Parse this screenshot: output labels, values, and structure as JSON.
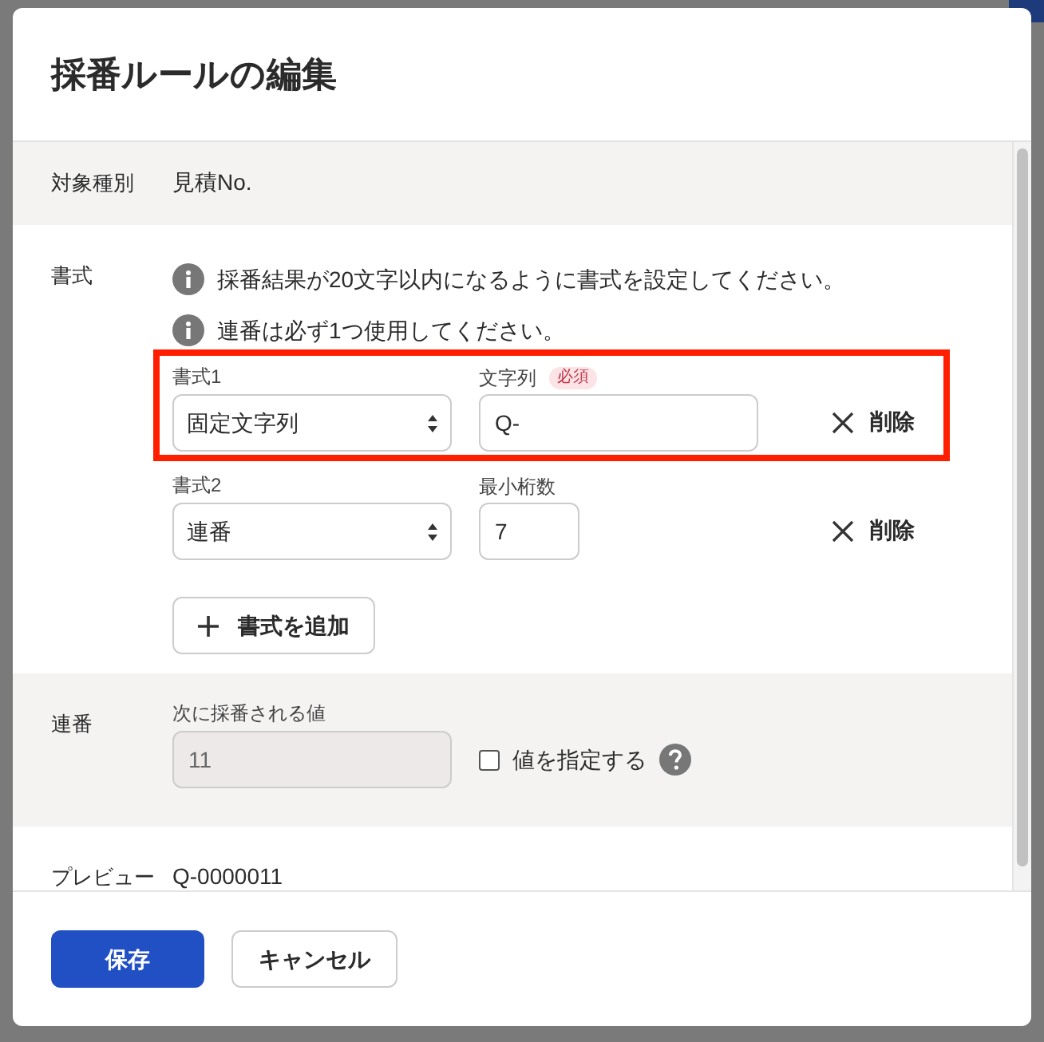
{
  "dialog": {
    "title": "採番ルールの編集"
  },
  "target": {
    "label": "対象種別",
    "value": "見積No."
  },
  "format": {
    "label": "書式",
    "notes": [
      "採番結果が20文字以内になるように書式を設定してください。",
      "連番は必ず1つ使用してください。"
    ],
    "rows": [
      {
        "label": "書式1",
        "select": "固定文字列",
        "field_label": "文字列",
        "badge": "必須",
        "value": "Q-",
        "kind": "text",
        "delete": "削除",
        "highlighted": true
      },
      {
        "label": "書式2",
        "select": "連番",
        "field_label": "最小桁数",
        "value": "7",
        "kind": "number",
        "delete": "削除",
        "highlighted": false
      }
    ],
    "add_button": "書式を追加"
  },
  "sequence": {
    "label": "連番",
    "field_label": "次に採番される値",
    "value": "11",
    "disabled": true,
    "checkbox": {
      "label": "値を指定する",
      "checked": false
    }
  },
  "preview": {
    "label": "プレビュー",
    "value": "Q-0000011"
  },
  "buttons": [
    {
      "label": "保存",
      "kind": "primary"
    },
    {
      "label": "キャンセル",
      "kind": "secondary"
    }
  ]
}
